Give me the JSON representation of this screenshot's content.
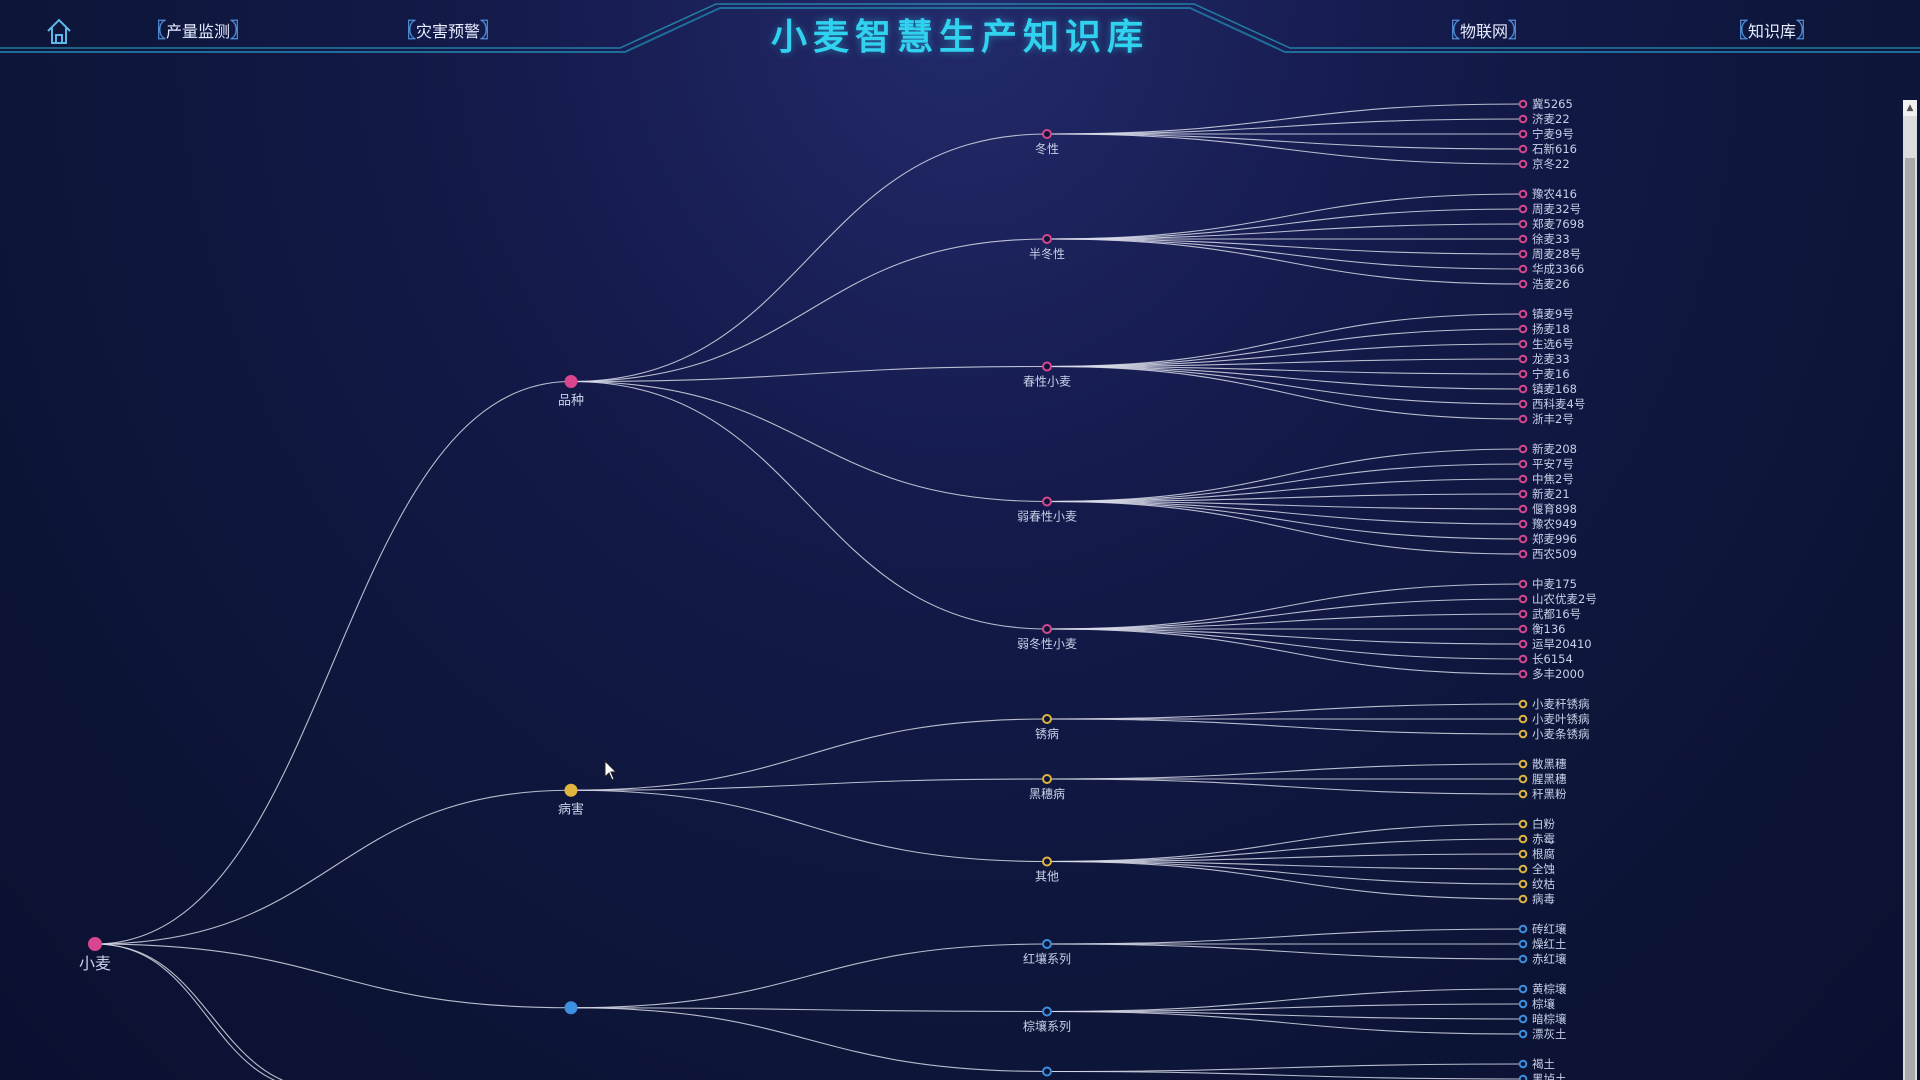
{
  "header": {
    "title": "小麦智慧生产知识库",
    "nav_left": [
      "产量监测",
      "灾害预警"
    ],
    "nav_right": [
      "物联网",
      "知识库"
    ],
    "home_icon": "home-icon"
  },
  "colors": {
    "variety": "#d9468f",
    "disease": "#e0b53d",
    "soil": "#3d8fe0",
    "link": "#d8dbe8",
    "title": "#31d2f0"
  },
  "tree": {
    "root": "小麦",
    "groups": [
      {
        "name": "品种",
        "color": "variety",
        "children": [
          {
            "name": "冬性",
            "leaves": [
              "冀5265",
              "济麦22",
              "宁麦9号",
              "石新616",
              "京冬22"
            ]
          },
          {
            "name": "半冬性",
            "leaves": [
              "豫农416",
              "周麦32号",
              "郑麦7698",
              "徐麦33",
              "周麦28号",
              "华成3366",
              "浩麦26"
            ]
          },
          {
            "name": "春性小麦",
            "leaves": [
              "镇麦9号",
              "扬麦18",
              "生选6号",
              "龙麦33",
              "宁麦16",
              "镇麦168",
              "西科麦4号",
              "浙丰2号"
            ]
          },
          {
            "name": "弱春性小麦",
            "leaves": [
              "新麦208",
              "平安7号",
              "中焦2号",
              "新麦21",
              "偃育898",
              "豫农949",
              "郑麦996",
              "西农509"
            ]
          },
          {
            "name": "弱冬性小麦",
            "leaves": [
              "中麦175",
              "山农优麦2号",
              "武都16号",
              "衡136",
              "运旱20410",
              "长6154",
              "多丰2000"
            ]
          }
        ]
      },
      {
        "name": "病害",
        "color": "disease",
        "children": [
          {
            "name": "锈病",
            "leaves": [
              "小麦秆锈病",
              "小麦叶锈病",
              "小麦条锈病"
            ]
          },
          {
            "name": "黑穗病",
            "leaves": [
              "散黑穗",
              "腥黑穗",
              "秆黑粉"
            ]
          },
          {
            "name": "其他",
            "leaves": [
              "白粉",
              "赤霉",
              "根腐",
              "全蚀",
              "纹枯",
              "病毒"
            ]
          }
        ]
      },
      {
        "name": "",
        "color": "soil",
        "children": [
          {
            "name": "红壤系列",
            "leaves": [
              "砖红壤",
              "燥红土",
              "赤红壤"
            ]
          },
          {
            "name": "棕壤系列",
            "leaves": [
              "黄棕壤",
              "棕壤",
              "暗棕壤",
              "漂灰土"
            ]
          },
          {
            "name": "",
            "leaves": [
              "褐土",
              "黑垆土"
            ]
          }
        ]
      }
    ]
  }
}
